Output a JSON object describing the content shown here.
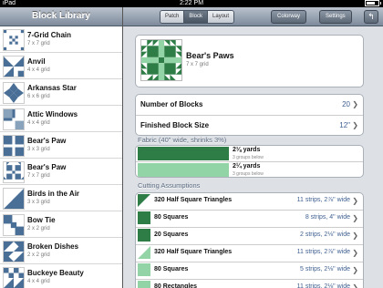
{
  "status": {
    "device": "iPad",
    "time": "2:22 PM"
  },
  "library": {
    "title": "Block Library",
    "items": [
      {
        "name": "7-Grid Chain",
        "grid": "7 x 7 grid"
      },
      {
        "name": "Anvil",
        "grid": "4 x 4 grid"
      },
      {
        "name": "Arkansas Star",
        "grid": "6 x 6 grid"
      },
      {
        "name": "Attic Windows",
        "grid": "4 x 4 grid"
      },
      {
        "name": "Bear's Paw",
        "grid": "3 x 3 grid"
      },
      {
        "name": "Bear's Paw",
        "grid": "7 x 7 grid"
      },
      {
        "name": "Birds in the Air",
        "grid": "3 x 3 grid"
      },
      {
        "name": "Bow Tie",
        "grid": "2 x 2 grid"
      },
      {
        "name": "Broken Dishes",
        "grid": "2 x 2 grid"
      },
      {
        "name": "Buckeye Beauty",
        "grid": "4 x 4 grid"
      }
    ]
  },
  "toolbar": {
    "tabs": [
      "Patch",
      "Block",
      "Layout"
    ],
    "active_tab": "Block",
    "colorway_label": "Colorway",
    "settings_label": "Settings",
    "back_icon": "back-arrow-icon"
  },
  "block": {
    "name": "Bear's Paws",
    "grid": "7 x 7 grid"
  },
  "settings": [
    {
      "label": "Number of Blocks",
      "value": "20"
    },
    {
      "label": "Finished Block Size",
      "value": "12\""
    }
  ],
  "fabric": {
    "title": "Fabric (40\" wide, shrinks 3%)",
    "rows": [
      {
        "yards": "2⅛ yards",
        "groups": "3 groups below",
        "color": "#2e7d46"
      },
      {
        "yards": "2¼ yards",
        "groups": "3 groups below",
        "color": "#93d4a7"
      }
    ]
  },
  "cutting": {
    "title": "Cutting Assumptions",
    "rows": [
      {
        "name": "320 Half Square Triangles",
        "value": "11 strips, 2⅞\" wide",
        "shape": "hst-dark"
      },
      {
        "name": "80 Squares",
        "value": "8 strips, 4\" wide",
        "shape": "square-dark"
      },
      {
        "name": "20 Squares",
        "value": "2 strips, 2⅛\" wide",
        "shape": "square-dark"
      },
      {
        "name": "320 Half Square Triangles",
        "value": "11 strips, 2⅞\" wide",
        "shape": "hst-light"
      },
      {
        "name": "80 Squares",
        "value": "5 strips, 2⅛\" wide",
        "shape": "square-light"
      },
      {
        "name": "80 Rectangles",
        "value": "11 strips, 2⅛\" wide",
        "shape": "square-light"
      }
    ]
  },
  "colors": {
    "dark_green": "#2e7d46",
    "light_green": "#93d4a7",
    "link_blue": "#3e5f90"
  }
}
